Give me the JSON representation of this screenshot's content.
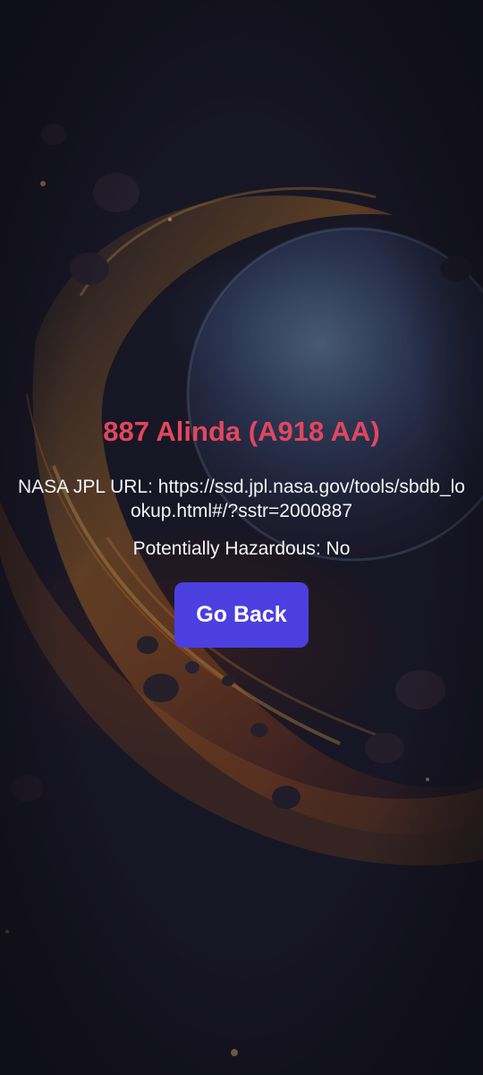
{
  "asteroid": {
    "title": "887 Alinda (A918 AA)",
    "url_line": "NASA JPL URL: https://ssd.jpl.nasa.gov/tools/sbdb_lookup.html#/?sstr=2000887",
    "hazard_line": "Potentially Hazardous: No"
  },
  "actions": {
    "go_back_label": "Go Back"
  },
  "theme": {
    "title_color": "#e0475e",
    "button_color": "#4b3fe0",
    "text_color": "#f4f4f8",
    "background": "#181726"
  }
}
